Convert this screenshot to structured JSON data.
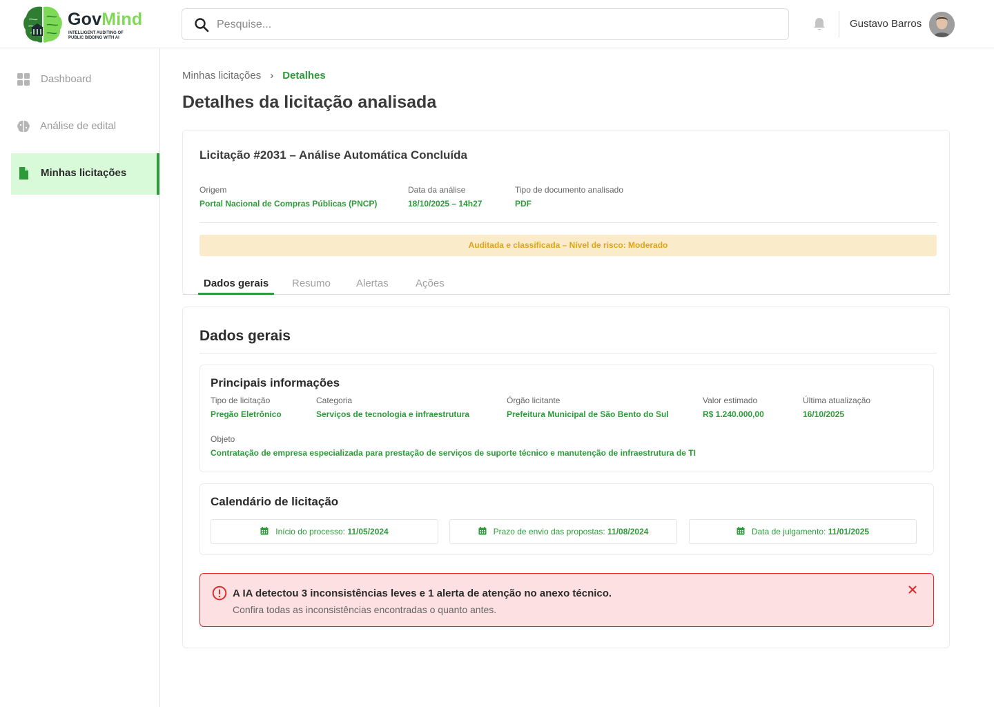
{
  "brand": {
    "name_part1": "Gov",
    "name_part2": "Mind",
    "tagline": "Intelligent auditing of public bidding with AI",
    "colors": {
      "dark": "#1f2a33",
      "light_green": "#7ed957",
      "dark_green": "#2e9a3a"
    }
  },
  "header": {
    "search_placeholder": "Pesquise...",
    "user_name": "Gustavo Barros"
  },
  "sidebar": {
    "items": [
      {
        "label": "Dashboard",
        "icon": "grid-icon",
        "active": false
      },
      {
        "label": "Análise de edital",
        "icon": "brain-icon",
        "active": false
      },
      {
        "label": "Minhas licitações",
        "icon": "document-icon",
        "active": true
      }
    ]
  },
  "breadcrumb": {
    "parent": "Minhas licitações",
    "separator": "›",
    "current": "Detalhes"
  },
  "page_title": "Detalhes da licitação analisada",
  "summary": {
    "title": "Licitação #2031 – Análise Automática Concluída",
    "fields": [
      {
        "label": "Origem",
        "value": "Portal Nacional de Compras Públicas (PNCP)"
      },
      {
        "label": "Data da análise",
        "value": "18/10/2025 – 14h27"
      },
      {
        "label": "Tipo de documento analisado",
        "value": "PDF"
      }
    ],
    "risk_text": "Auditada e classificada – Nível de risco: Moderado",
    "risk_colors": {
      "background": "#faeccb",
      "text": "#e0a412"
    }
  },
  "tabs": [
    {
      "label": "Dados gerais",
      "active": true
    },
    {
      "label": "Resumo",
      "active": false
    },
    {
      "label": "Alertas",
      "active": false
    },
    {
      "label": "Ações",
      "active": false
    }
  ],
  "general": {
    "section_title": "Dados gerais",
    "info": {
      "title": "Principais informações",
      "fields": [
        {
          "label": "Tipo de licitação",
          "value": "Pregão Eletrônico"
        },
        {
          "label": "Categoria",
          "value": "Serviços de tecnologia e infraestrutura"
        },
        {
          "label": "Órgão licitante",
          "value": "Prefeitura Municipal de São Bento do Sul"
        },
        {
          "label": "Valor estimado",
          "value": "R$ 1.240.000,00"
        },
        {
          "label": "Última atualização",
          "value": "16/10/2025"
        }
      ],
      "object_label": "Objeto",
      "object_value": "Contratação de empresa especializada para prestação de serviços de suporte técnico e manutenção de infraestrutura de TI"
    },
    "calendar": {
      "title": "Calendário de licitação",
      "items": [
        {
          "label": "Início do processo: ",
          "date": "11/05/2024"
        },
        {
          "label": "Prazo de envio das propostas: ",
          "date": "11/08/2024"
        },
        {
          "label": "Data de julgamento: ",
          "date": "11/01/2025"
        }
      ]
    },
    "alert": {
      "title": "A IA detectou 3 inconsistências leves e 1 alerta de atenção no anexo técnico.",
      "subtitle": "Confira todas as inconsistências encontradas o quanto antes.",
      "colors": {
        "background": "#fde1e2",
        "border": "#e02b2b"
      }
    }
  }
}
